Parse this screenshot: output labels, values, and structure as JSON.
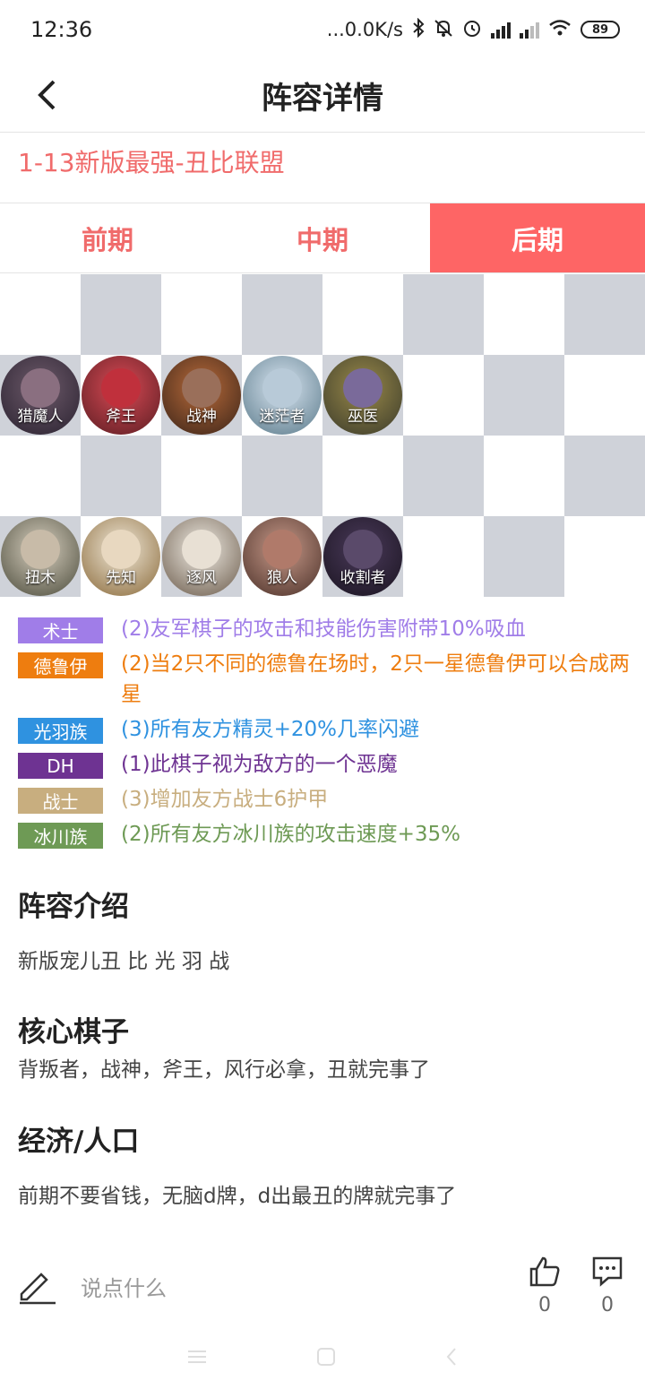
{
  "status_bar": {
    "time": "12:36",
    "network_speed": "...0.0K/s",
    "battery": "89"
  },
  "header": {
    "title": "阵容详情"
  },
  "comp_title": "1-13新版最强-丑比联盟",
  "tabs": [
    {
      "label": "前期",
      "active": false
    },
    {
      "label": "中期",
      "active": false
    },
    {
      "label": "后期",
      "active": true
    }
  ],
  "board": {
    "row2": [
      "猎魔人",
      "斧王",
      "战神",
      "迷茫者",
      "巫医"
    ],
    "row4": [
      "扭木",
      "先知",
      "逐风",
      "狼人",
      "收割者"
    ]
  },
  "synergies": [
    {
      "badge": "术士",
      "text": "(2)友军棋子的攻击和技能伤害附带10%吸血",
      "color": "#a07de8"
    },
    {
      "badge": "德鲁伊",
      "text": "(2)当2只不同的德鲁在场时，2只一星德鲁伊可以合成两星",
      "color": "#ee7d0f"
    },
    {
      "badge": "光羽族",
      "text": "(3)所有友方精灵+20%几率闪避",
      "color": "#2f92e0"
    },
    {
      "badge": "DH",
      "text": "(1)此棋子视为敌方的一个恶魔",
      "color": "#6e3392"
    },
    {
      "badge": "战士",
      "text": "(3)增加友方战士6护甲",
      "color": "#c8ae7f"
    },
    {
      "badge": "冰川族",
      "text": "(2)所有友方冰川族的攻击速度+35%",
      "color": "#6e9a55"
    }
  ],
  "intro": {
    "title": "阵容介绍",
    "text": "新版宠儿丑 比 光 羽 战"
  },
  "core": {
    "title": "核心棋子",
    "text": "背叛者，战神，斧王，风行必拿，丑就完事了"
  },
  "economy": {
    "title": "经济/人口",
    "text": "前期不要省钱，无脑d牌，d出最丑的牌就完事了"
  },
  "bottom_bar": {
    "comment_placeholder": "说点什么",
    "like_count": "0",
    "comment_count": "0"
  }
}
